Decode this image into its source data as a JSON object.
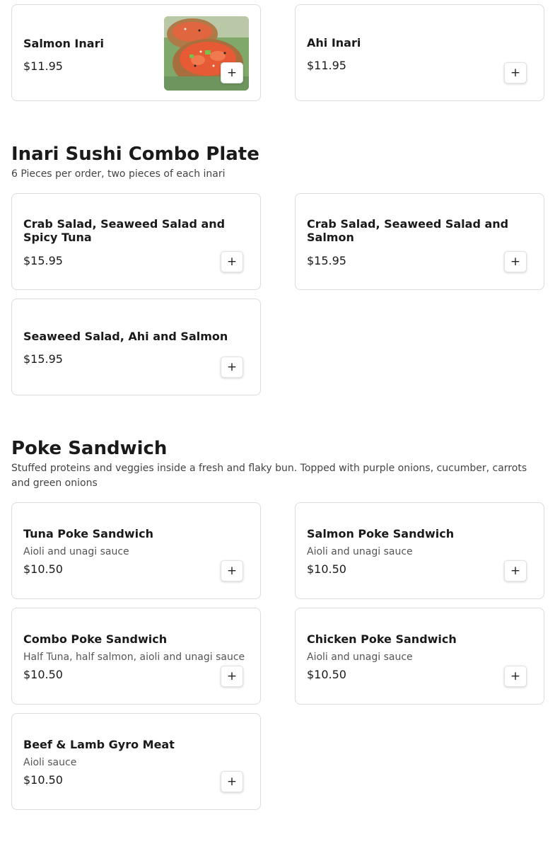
{
  "sections": [
    {
      "items": [
        {
          "name": "Salmon Inari",
          "price": "$11.95",
          "image": "salmon-inari-photo"
        },
        {
          "name": "Ahi Inari",
          "price": "$11.95"
        }
      ]
    },
    {
      "title": "Inari Sushi Combo Plate",
      "description": "6 Pieces per order, two pieces of each inari",
      "items": [
        {
          "name": "Crab Salad, Seaweed Salad and Spicy Tuna",
          "price": "$15.95"
        },
        {
          "name": "Crab Salad, Seaweed Salad and Salmon",
          "price": "$15.95"
        },
        {
          "name": "Seaweed Salad, Ahi and Salmon",
          "price": "$15.95"
        }
      ]
    },
    {
      "title": "Poke Sandwich",
      "description": "Stuffed proteins and veggies inside a fresh and flaky bun. Topped with purple onions, cucumber, carrots and green onions",
      "items": [
        {
          "name": "Tuna Poke Sandwich",
          "description": "Aioli and unagi sauce",
          "price": "$10.50"
        },
        {
          "name": "Salmon Poke Sandwich",
          "description": "Aioli and unagi sauce",
          "price": "$10.50"
        },
        {
          "name": "Combo Poke Sandwich",
          "description": "Half Tuna, half salmon, aioli and unagi sauce",
          "price": "$10.50"
        },
        {
          "name": "Chicken Poke Sandwich",
          "description": "Aioli and unagi sauce",
          "price": "$10.50"
        },
        {
          "name": "Beef & Lamb Gyro Meat",
          "description": "Aioli sauce",
          "price": "$10.50"
        }
      ]
    }
  ],
  "add_button": {
    "label": "+",
    "icon": "plus-icon"
  }
}
